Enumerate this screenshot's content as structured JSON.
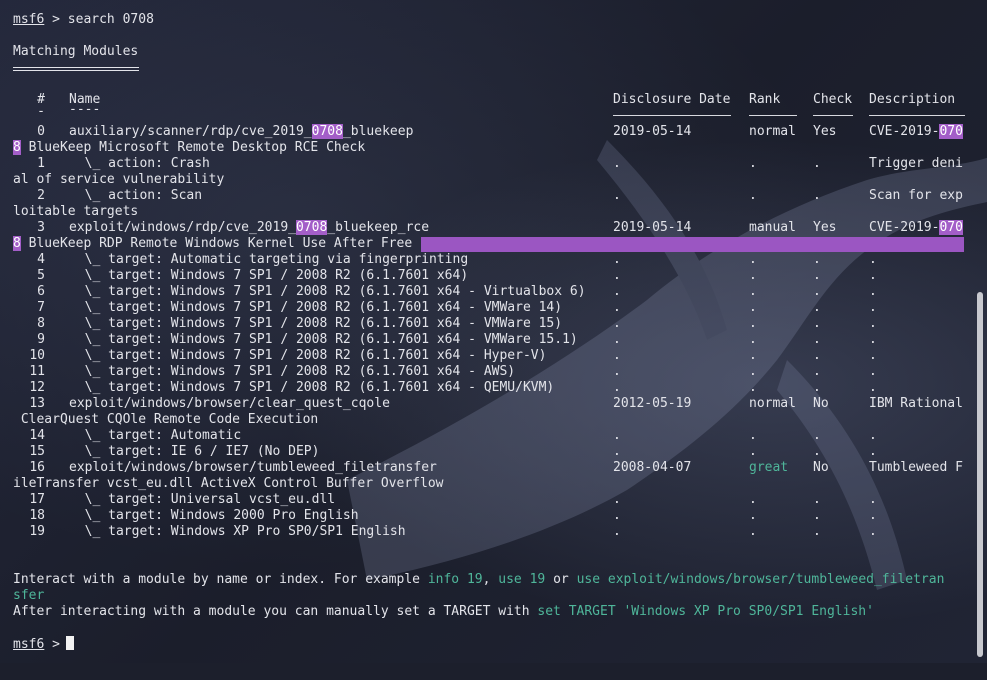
{
  "prompt": "msf6",
  "prompt_arrow": ">",
  "command": "search 0708",
  "heading": "Matching Modules",
  "columns": {
    "num": "#",
    "name": "Name",
    "date": "Disclosure Date",
    "rank": "Rank",
    "check": "Check",
    "desc": "Description"
  },
  "header_dashes": {
    "num": "-",
    "name": "----"
  },
  "rows": [
    {
      "num": "0",
      "name_pre": "auxiliary/scanner/rdp/cve_2019_",
      "name_hl": "0708",
      "name_post": "_bluekeep",
      "date": "2019-05-14",
      "rank": "normal",
      "check": "Yes",
      "desc_pre": "CVE-2019-",
      "desc_hl": "070",
      "wrap_hl": "8",
      "wrap": " BlueKeep Microsoft Remote Desktop RCE Check"
    },
    {
      "num": "1",
      "name": "  \\_ action: Crash",
      "date": ".",
      "rank": ".",
      "check": ".",
      "desc": "Trigger deni",
      "wrap": "al of service vulnerability"
    },
    {
      "num": "2",
      "name": "  \\_ action: Scan",
      "date": ".",
      "rank": ".",
      "check": ".",
      "desc": "Scan for exp",
      "wrap": "loitable targets"
    },
    {
      "num": "3",
      "name_pre": "exploit/windows/rdp/cve_2019_",
      "name_hl": "0708",
      "name_post": "_bluekeep_rce",
      "date": "2019-05-14",
      "rank": "manual",
      "check": "Yes",
      "desc_pre": "CVE-2019-",
      "desc_hl": "070",
      "wrap_hl": "8",
      "wrap": " BlueKeep RDP Remote Windows Kernel Use After Free"
    },
    {
      "num": "4",
      "name": "  \\_ target: Automatic targeting via fingerprinting",
      "date": ".",
      "rank": ".",
      "check": ".",
      "desc": "."
    },
    {
      "num": "5",
      "name": "  \\_ target: Windows 7 SP1 / 2008 R2 (6.1.7601 x64)",
      "date": ".",
      "rank": ".",
      "check": ".",
      "desc": "."
    },
    {
      "num": "6",
      "name": "  \\_ target: Windows 7 SP1 / 2008 R2 (6.1.7601 x64 - Virtualbox 6)",
      "date": ".",
      "rank": ".",
      "check": ".",
      "desc": "."
    },
    {
      "num": "7",
      "name": "  \\_ target: Windows 7 SP1 / 2008 R2 (6.1.7601 x64 - VMWare 14)",
      "date": ".",
      "rank": ".",
      "check": ".",
      "desc": "."
    },
    {
      "num": "8",
      "name": "  \\_ target: Windows 7 SP1 / 2008 R2 (6.1.7601 x64 - VMWare 15)",
      "date": ".",
      "rank": ".",
      "check": ".",
      "desc": "."
    },
    {
      "num": "9",
      "name": "  \\_ target: Windows 7 SP1 / 2008 R2 (6.1.7601 x64 - VMWare 15.1)",
      "date": ".",
      "rank": ".",
      "check": ".",
      "desc": "."
    },
    {
      "num": "10",
      "name": "  \\_ target: Windows 7 SP1 / 2008 R2 (6.1.7601 x64 - Hyper-V)",
      "date": ".",
      "rank": ".",
      "check": ".",
      "desc": "."
    },
    {
      "num": "11",
      "name": "  \\_ target: Windows 7 SP1 / 2008 R2 (6.1.7601 x64 - AWS)",
      "date": ".",
      "rank": ".",
      "check": ".",
      "desc": "."
    },
    {
      "num": "12",
      "name": "  \\_ target: Windows 7 SP1 / 2008 R2 (6.1.7601 x64 - QEMU/KVM)",
      "date": ".",
      "rank": ".",
      "check": ".",
      "desc": "."
    },
    {
      "num": "13",
      "name": "exploit/windows/browser/clear_quest_cqole",
      "date": "2012-05-19",
      "rank": "normal",
      "check": "No",
      "desc": "IBM Rational",
      "wrap": " ClearQuest CQOle Remote Code Execution"
    },
    {
      "num": "14",
      "name": "  \\_ target: Automatic",
      "date": ".",
      "rank": ".",
      "check": ".",
      "desc": "."
    },
    {
      "num": "15",
      "name": "  \\_ target: IE 6 / IE7 (No DEP)",
      "date": ".",
      "rank": ".",
      "check": ".",
      "desc": "."
    },
    {
      "num": "16",
      "name": "exploit/windows/browser/tumbleweed_filetransfer",
      "date": "2008-04-07",
      "rank": "great",
      "check": "No",
      "desc": "Tumbleweed F",
      "wrap": "ileTransfer vcst_eu.dll ActiveX Control Buffer Overflow"
    },
    {
      "num": "17",
      "name": "  \\_ target: Universal vcst_eu.dll",
      "date": ".",
      "rank": ".",
      "check": ".",
      "desc": "."
    },
    {
      "num": "18",
      "name": "  \\_ target: Windows 2000 Pro English",
      "date": ".",
      "rank": ".",
      "check": ".",
      "desc": "."
    },
    {
      "num": "19",
      "name": "  \\_ target: Windows XP Pro SP0/SP1 English",
      "date": ".",
      "rank": ".",
      "check": ".",
      "desc": "."
    }
  ],
  "footer": {
    "l1_a": "Interact with a module by name or index. For example ",
    "l1_b": "info 19",
    "l1_c": ", ",
    "l1_d": "use 19",
    "l1_e": " or ",
    "l1_f": "use exploit/windows/browser/tumbleweed_filetran",
    "l2": "sfer",
    "l3_a": "After interacting with a module you can manually set a TARGET with ",
    "l3_b": "set TARGET 'Windows XP Pro SP0/SP1 English'"
  },
  "colors": {
    "background": "#1c1f2c",
    "text": "#e3e4ea",
    "highlight": "#a35ec8",
    "green": "#4fb69a"
  },
  "icons": [
    "dragon-watermark-icon",
    "cursor-block-icon"
  ]
}
